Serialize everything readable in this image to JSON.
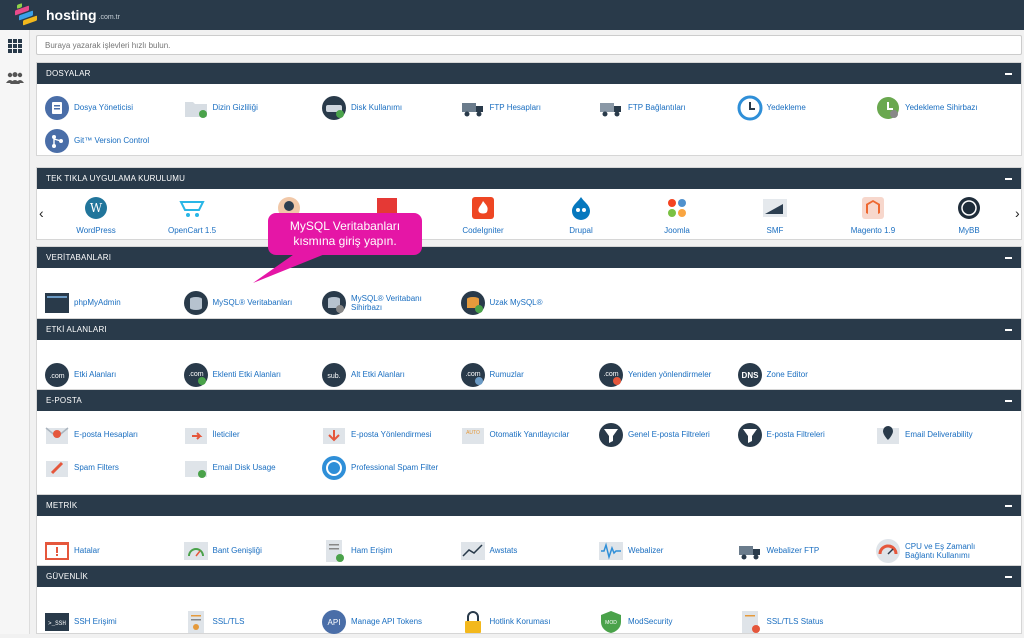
{
  "brand": {
    "name": "hosting",
    "suffix": ".com.tr"
  },
  "search": {
    "placeholder": "Buraya yazarak işlevleri hızlı bulun."
  },
  "callout": {
    "line1": "MySQL Veritabanları",
    "line2": "kısmına giriş yapın."
  },
  "sections": {
    "dosyalar": {
      "title": "DOSYALAR",
      "items": [
        "Dosya Yöneticisi",
        "Dizin Gizliliği",
        "Disk Kullanımı",
        "FTP Hesapları",
        "FTP Bağlantıları",
        "Yedekleme",
        "Yedekleme Sihirbazı",
        "Git™ Version Control"
      ]
    },
    "apps": {
      "title": "TEK TIKLA UYGULAMA KURULUMU",
      "items": [
        "WordPress",
        "OpenCart 1.5",
        "",
        "",
        "CodeIgniter",
        "Drupal",
        "Joomla",
        "SMF",
        "Magento 1.9",
        "MyBB"
      ],
      "prev": "‹",
      "next": "›"
    },
    "veritabanlari": {
      "title": "VERİTABANLARI",
      "items": [
        "phpMyAdmin",
        "MySQL® Veritabanları",
        "MySQL® Veritabanı Sihirbazı",
        "Uzak MySQL®"
      ]
    },
    "etki": {
      "title": "ETKİ ALANLARI",
      "items": [
        "Etki Alanları",
        "Eklenti Etki Alanları",
        "Alt Etki Alanları",
        "Rumuzlar",
        "Yeniden yönlendirmeler",
        "Zone Editor"
      ]
    },
    "eposta": {
      "title": "E-POSTA",
      "items": [
        "E-posta Hesapları",
        "İleticiler",
        "E-posta Yönlendirmesi",
        "Otomatik Yanıtlayıcılar",
        "Genel E-posta Filtreleri",
        "E-posta Filtreleri",
        "Email Deliverability",
        "Spam Filters",
        "Email Disk Usage",
        "Professional Spam Filter"
      ]
    },
    "metrik": {
      "title": "METRİK",
      "items": [
        "Hatalar",
        "Bant Genişliği",
        "Ham Erişim",
        "Awstats",
        "Webalizer",
        "Webalizer FTP",
        "CPU ve Eş Zamanlı Bağlantı Kullanımı"
      ]
    },
    "guvenlik": {
      "title": "GÜVENLİK",
      "items": [
        "SSH Erişimi",
        "SSL/TLS",
        "Manage API Tokens",
        "Hotlink Koruması",
        "ModSecurity",
        "SSL/TLS Status"
      ]
    }
  },
  "icon_text": {
    "com": ".com",
    "sub": "sub.",
    "dns": "DNS",
    "api": "API",
    "ssh": ">_SSH",
    "mod": "MOD",
    "auto": "AUTO"
  },
  "colors": {
    "header": "#293a4a",
    "link": "#1a6ec0",
    "callout": "#e516a6"
  }
}
